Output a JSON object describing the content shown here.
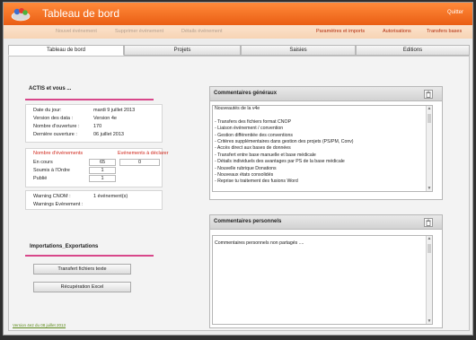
{
  "header": {
    "title": "Tableau de bord",
    "quit_label": "Quitter"
  },
  "subbar": {
    "new_event": "Nouvel événement",
    "delete_event": "Supprimer événement",
    "event_details": "Détails événement",
    "settings_imports": "Paramètres et imports",
    "authorizations": "Autorisations",
    "transfer_bases": "Transfers bases"
  },
  "tabs": [
    "Tableau de bord",
    "Projets",
    "Saisies",
    "Editions"
  ],
  "actis": {
    "title": "ACTIS et vous ...",
    "rows": [
      {
        "label": "Date du jour:",
        "value": "mardi 9 juillet 2013"
      },
      {
        "label": "Version des data :",
        "value": "Version 4e"
      },
      {
        "label": "Nombre d'ouverture :",
        "value": "170"
      },
      {
        "label": "Dernière ouverture :",
        "value": "06 juillet 2013"
      }
    ]
  },
  "events": {
    "header": "Nombre d'événements",
    "to_declare_header": "Evénements à déclarer",
    "to_declare_value": "0",
    "rows": [
      {
        "label": "En cours",
        "value": "65"
      },
      {
        "label": "Soumis à l'Ordre",
        "value": "1"
      },
      {
        "label": "Publié",
        "value": "1"
      }
    ]
  },
  "warnings": {
    "cnom_label": "Warning CNOM :",
    "cnom_value": "1 événement(s)",
    "event_label": "Warnings Evènement :",
    "event_value": ""
  },
  "imports": {
    "title": "Importations_Exportations",
    "transfer_button": "Transfert fichiers texte",
    "excel_button": "Récupération Excel"
  },
  "version_link": "Version 4e2 du 08 juillet 2013",
  "general_comments": {
    "title": "Commentaires généraux",
    "lines": [
      "Nouveautés de la v4e",
      "",
      "- Transfers des fichiers format CNOP",
      "- Liaison événement / convention",
      "- Gestion différentiée des conventions",
      "- Critères supplémentaires dans gestion des projets (PS/PM, Conv)",
      "- Accès direct aux bases de données",
      "- Transfert entre base manuelle et base médicale",
      "- Détails individuels des avantages par PS de la base médicale",
      "- Nouvelle rubrique Donations",
      "- Nouveaux états consolidés",
      "- Reprise tu traitement des fusions Word"
    ]
  },
  "personal_comments": {
    "title": "Commentaires personnels",
    "text": "Commentaires personnels non partagés ...."
  },
  "icons": {
    "logo": "app-logo-icon",
    "trash": "trash-icon"
  },
  "colors": {
    "header_orange": "#ea5e14",
    "accent_pink": "#d8478a",
    "alert_red": "#d0271b",
    "link_green": "#5e8a1c"
  }
}
